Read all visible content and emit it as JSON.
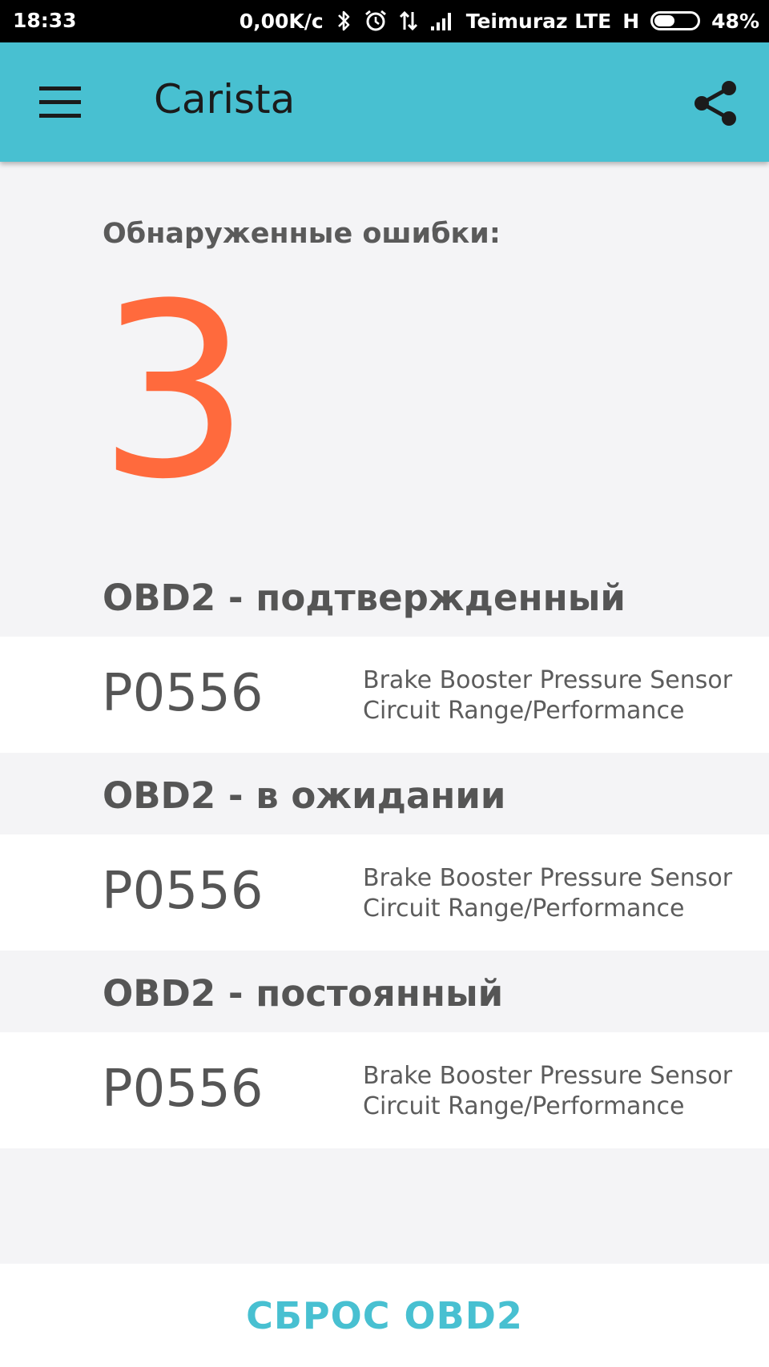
{
  "status_bar": {
    "time": "18:33",
    "speed": "0,00K/c",
    "carrier": "Teimuraz LTE",
    "network_type": "H",
    "battery": "48%",
    "icons": [
      "bluetooth-icon",
      "alarm-icon",
      "data-transfer-icon",
      "signal-icon",
      "battery-icon"
    ]
  },
  "app_bar": {
    "title": "Carista",
    "color": "#48c0d1",
    "icons": [
      "menu-icon",
      "share-icon"
    ]
  },
  "summary": {
    "label": "Обнаруженные ошибки:",
    "count": "3",
    "count_color": "#ff6a3d"
  },
  "sections": [
    {
      "title": "OBD2 - подтвержденный",
      "codes": [
        {
          "code": "P0556",
          "desc_line1": "Brake Booster Pressure Sensor",
          "desc_line2": "Circuit Range/Performance"
        }
      ]
    },
    {
      "title": "OBD2 - в ожидании",
      "codes": [
        {
          "code": "P0556",
          "desc_line1": "Brake Booster Pressure Sensor",
          "desc_line2": "Circuit Range/Performance"
        }
      ]
    },
    {
      "title": "OBD2 - постоянный",
      "codes": [
        {
          "code": "P0556",
          "desc_line1": "Brake Booster Pressure Sensor",
          "desc_line2": "Circuit Range/Performance"
        }
      ]
    }
  ],
  "footer": {
    "reset_label": "СБРОС OBD2"
  }
}
